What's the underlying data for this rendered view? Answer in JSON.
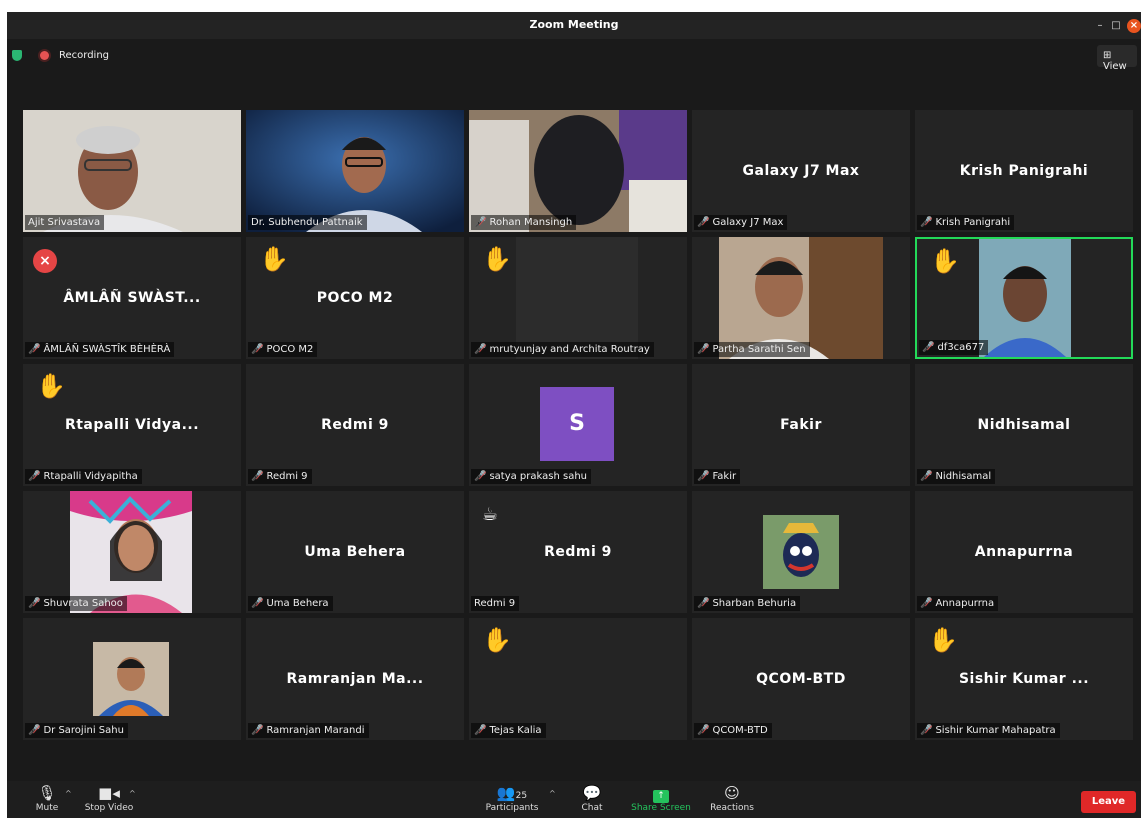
{
  "window": {
    "title": "Zoom Meeting"
  },
  "topbar": {
    "recording_label": "Recording",
    "view_label": "⊞ View"
  },
  "tiles": [
    {
      "name": "Ajit Srivastava"
    },
    {
      "name": "Dr. Subhendu Pattnaik"
    },
    {
      "name": "Rohan Mansingh"
    },
    {
      "name": "Galaxy J7 Max",
      "big": "Galaxy J7 Max"
    },
    {
      "name": "Krish Panigrahi",
      "big": "Krish Panigrahi"
    },
    {
      "name": "ÂMLÂÑ SWÀSTÎK BÈHÈRÀ",
      "big": "ÂMLÂÑ SWÀST..."
    },
    {
      "name": "POCO M2",
      "big": "POCO M2"
    },
    {
      "name": "mrutyunjay and Archita Routray"
    },
    {
      "name": "Partha Sarathi Sen"
    },
    {
      "name": "df3ca677"
    },
    {
      "name": "Rtapalli Vidyapitha",
      "big": "Rtapalli Vidya..."
    },
    {
      "name": "Redmi 9",
      "big": "Redmi 9"
    },
    {
      "name": "satya prakash sahu",
      "avatar": "S"
    },
    {
      "name": "Fakir",
      "big": "Fakir"
    },
    {
      "name": "Nidhisamal",
      "big": "Nidhisamal"
    },
    {
      "name": "Shuvrata Sahoo"
    },
    {
      "name": "Uma Behera",
      "big": "Uma Behera"
    },
    {
      "name": "Redmi 9",
      "big": "Redmi 9"
    },
    {
      "name": "Sharban Behuria"
    },
    {
      "name": "Annapurrna",
      "big": "Annapurrna"
    },
    {
      "name": "Dr Sarojini Sahu"
    },
    {
      "name": "Ramranjan Marandi",
      "big": "Ramranjan Ma..."
    },
    {
      "name": "Tejas Kalia"
    },
    {
      "name": "QCOM-BTD",
      "big": "QCOM-BTD"
    },
    {
      "name": "Sishir Kumar Mahapatra",
      "big": "Sishir Kumar ..."
    }
  ],
  "toolbar": {
    "mute": "Mute",
    "stop_video": "Stop Video",
    "participants": "Participants",
    "participants_count": "25",
    "chat": "Chat",
    "share_screen": "Share Screen",
    "reactions": "Reactions",
    "leave": "Leave"
  },
  "colors": {
    "accent_green": "#24c35d",
    "leave_red": "#e02828",
    "recording_red": "#e55353"
  }
}
